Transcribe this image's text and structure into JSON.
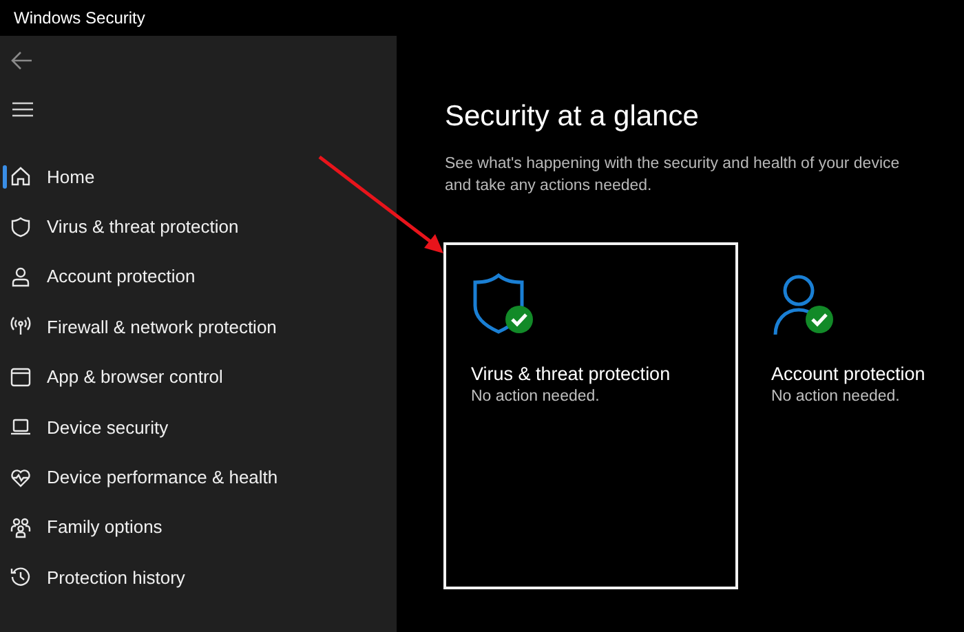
{
  "window": {
    "title": "Windows Security"
  },
  "sidebar": {
    "items": [
      {
        "label": "Home",
        "selected": true
      },
      {
        "label": "Virus & threat protection",
        "selected": false
      },
      {
        "label": "Account protection",
        "selected": false
      },
      {
        "label": "Firewall & network protection",
        "selected": false
      },
      {
        "label": "App & browser control",
        "selected": false
      },
      {
        "label": "Device security",
        "selected": false
      },
      {
        "label": "Device performance & health",
        "selected": false
      },
      {
        "label": "Family options",
        "selected": false
      },
      {
        "label": "Protection history",
        "selected": false
      }
    ]
  },
  "main": {
    "heading": "Security at a glance",
    "description": "See what's happening with the security and health of your device and take any actions needed.",
    "cards": [
      {
        "title": "Virus & threat protection",
        "status": "No action needed.",
        "focused": true
      },
      {
        "title": "Account protection",
        "status": "No action needed.",
        "focused": false
      }
    ]
  }
}
